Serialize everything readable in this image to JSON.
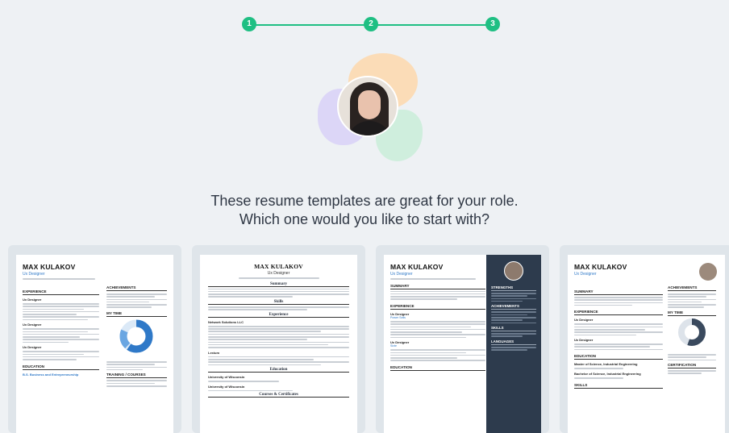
{
  "stepper": {
    "steps": [
      "1",
      "2",
      "3"
    ]
  },
  "headline": {
    "line1": "These resume templates are great for your role.",
    "line2": "Which one would you like to start with?"
  },
  "templates": [
    {
      "name": "MAX KULAKOV",
      "title": "Ux Designer",
      "sections": [
        "EXPERIENCE",
        "ACHIEVEMENTS",
        "MY TIME",
        "TRAINING / COURSES",
        "EDUCATION"
      ],
      "jobs": [
        "Ux Designer",
        "Ux Designer",
        "Ux Designer"
      ],
      "education": "B.S. Business and Entrepreneurship"
    },
    {
      "name": "MAX KULAKOV",
      "title": "Ux Designer",
      "sections": [
        "Summary",
        "Skills",
        "Experience",
        "Education",
        "Courses & Certificates"
      ],
      "companies": [
        "Network Solutions LLC",
        "Lexium"
      ],
      "schools": [
        "University of Wisconsin",
        "University of Wisconsin"
      ]
    },
    {
      "name": "MAX KULAKOV",
      "title": "Ux Designer",
      "sections": [
        "SUMMARY",
        "EXPERIENCE",
        "EDUCATION",
        "STRENGTHS",
        "ACHIEVEMENTS",
        "SKILLS",
        "LANGUAGES"
      ],
      "jobs": [
        "Ux Designer",
        "Ux Designer"
      ],
      "companies": [
        "Power Sells",
        "Sixte"
      ]
    },
    {
      "name": "MAX KULAKOV",
      "title": "Ux Designer",
      "sections": [
        "SUMMARY",
        "EXPERIENCE",
        "EDUCATION",
        "SKILLS",
        "ACHIEVEMENTS",
        "MY TIME",
        "CERTIFICATION"
      ],
      "jobs": [
        "Ux Designer",
        "Ux Designer"
      ],
      "education": [
        "Master of Science, Industrial Engineering",
        "Bachelor of Science, Industrial Engineering"
      ]
    }
  ],
  "colors": {
    "accent": "#1fbf83",
    "link": "#2f79c8",
    "dark_panel": "#2d3b4d"
  }
}
